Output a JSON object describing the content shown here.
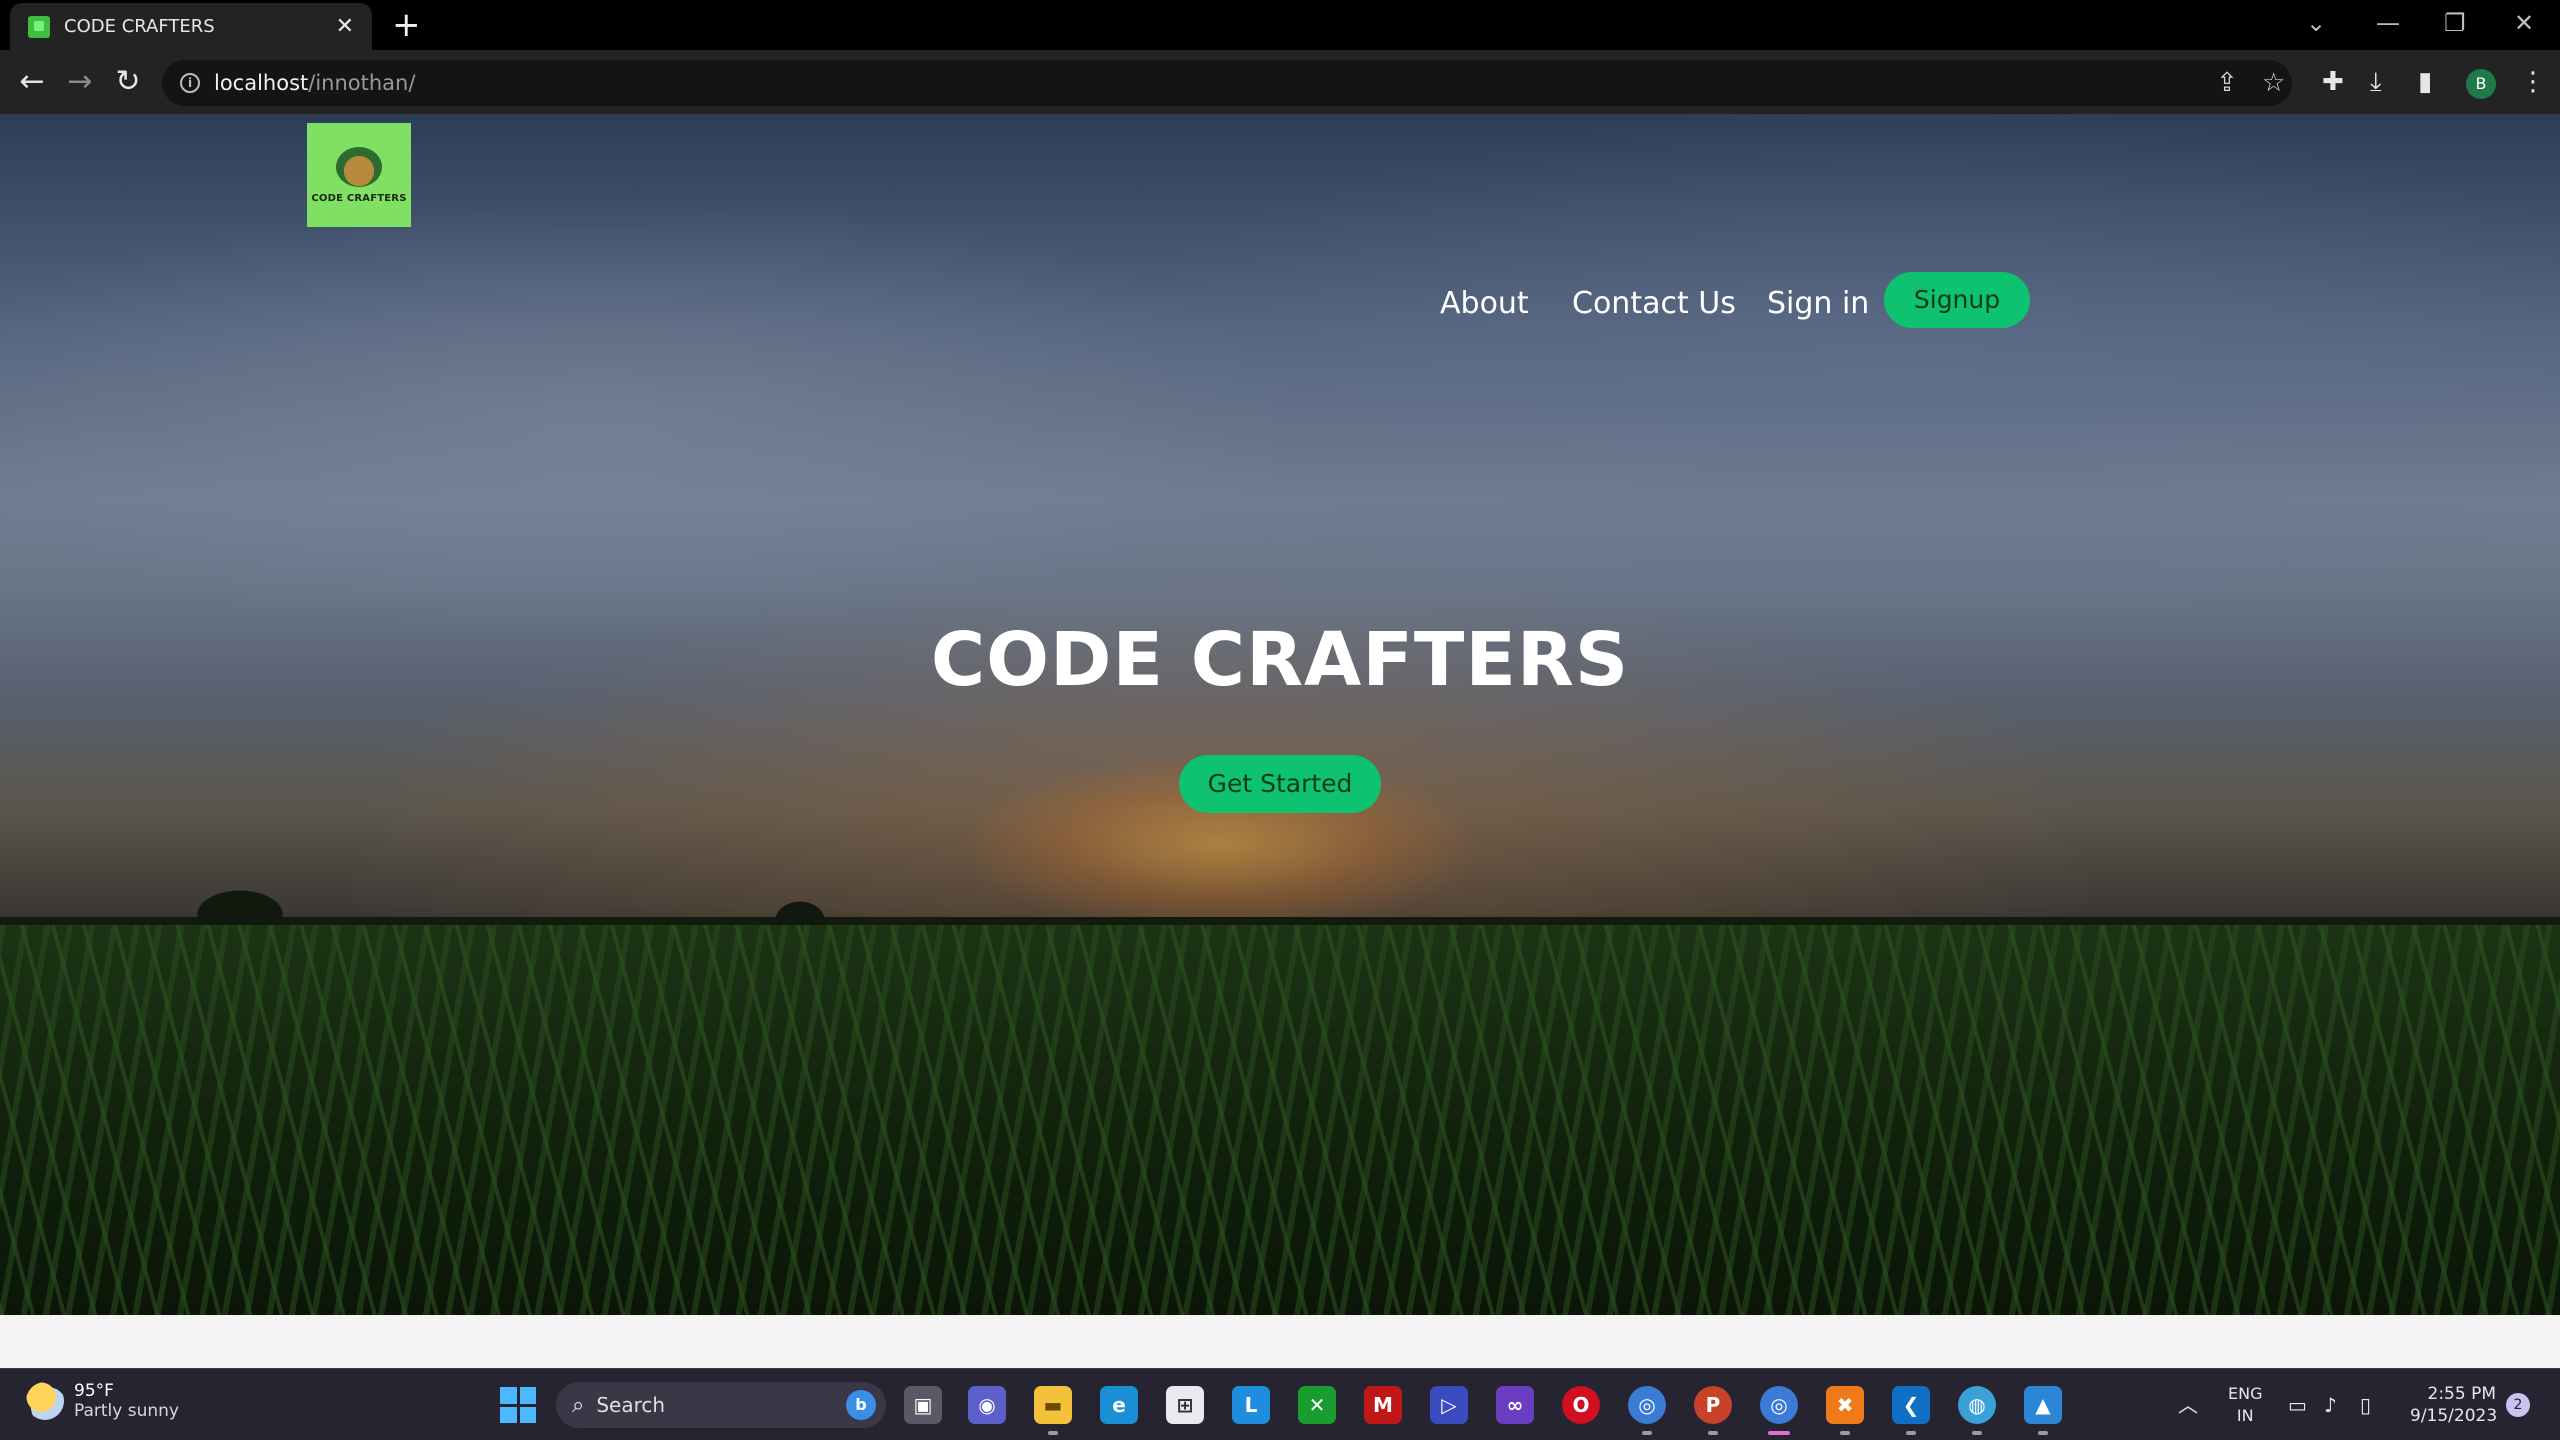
{
  "browser": {
    "tab_title": "CODE CRAFTERS",
    "tab_close": "✕",
    "new_tab": "+",
    "window_controls": [
      "⌄",
      "—",
      "❐",
      "✕"
    ],
    "url_host": "localhost",
    "url_path": "/innothan/",
    "profile_initial": "B"
  },
  "site": {
    "logo_text": "CODE CRAFTERS",
    "nav": {
      "about": "About",
      "contact": "Contact Us",
      "signin": "Sign in",
      "signup": "Signup"
    },
    "hero_title": "CODE CRAFTERS",
    "cta": "Get Started",
    "colors": {
      "accent": "#0ec26f",
      "logo_bg": "#7fe064"
    }
  },
  "taskbar": {
    "weather_temp": "95°F",
    "weather_desc": "Partly sunny",
    "search_label": "Search",
    "apps": [
      "task-view",
      "teams-chat",
      "file-explorer",
      "edge",
      "microsoft-store",
      "lens-app",
      "xbox",
      "mcafee",
      "power-automate",
      "visual-studio",
      "opera",
      "chrome-profile",
      "powerpoint",
      "chrome",
      "xampp",
      "vscode",
      "earth-app",
      "photos"
    ],
    "lang_line1": "ENG",
    "lang_line2": "IN",
    "time": "2:55 PM",
    "date": "9/15/2023",
    "notification_count": "2"
  }
}
